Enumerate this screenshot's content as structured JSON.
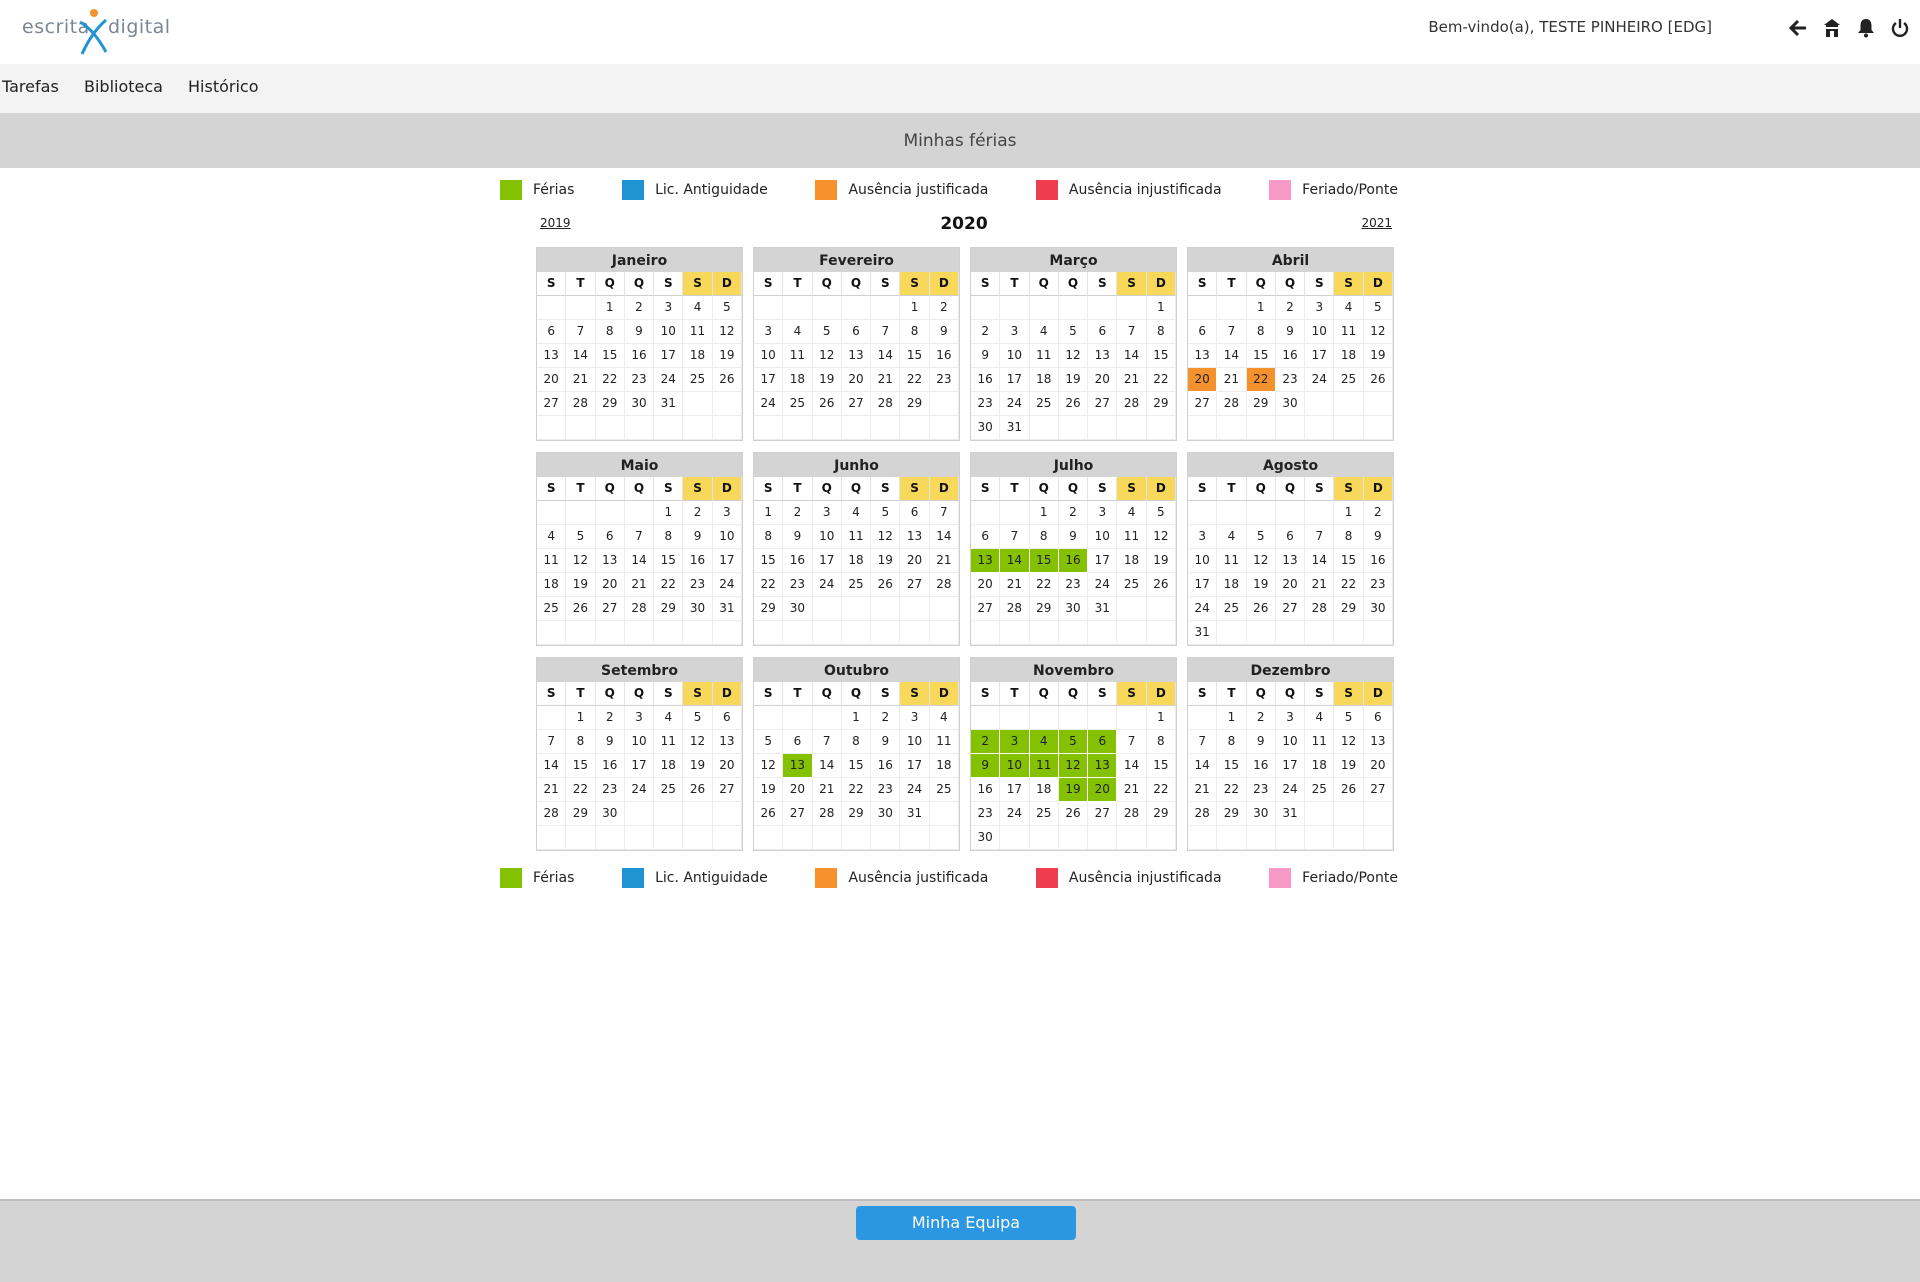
{
  "header": {
    "logo_left": "escrita",
    "logo_right": "digital",
    "welcome": "Bem-vindo(a), TESTE PINHEIRO [EDG]",
    "icons": [
      "back-arrow-icon",
      "home-icon",
      "bell-icon",
      "power-icon"
    ]
  },
  "nav": {
    "items": [
      "Tarefas",
      "Biblioteca",
      "Histórico"
    ]
  },
  "page": {
    "title": "Minhas férias"
  },
  "legend": [
    {
      "label": "Férias",
      "color": "#84c100"
    },
    {
      "label": "Lic. Antiguidade",
      "color": "#1f94d2"
    },
    {
      "label": "Ausência justificada",
      "color": "#f5922d"
    },
    {
      "label": "Ausência injustificada",
      "color": "#ee3e4d"
    },
    {
      "label": "Feriado/Ponte",
      "color": "#f798c6"
    }
  ],
  "year_nav": {
    "prev": "2019",
    "current": "2020",
    "next": "2021"
  },
  "weekday_headers": [
    "S",
    "T",
    "Q",
    "Q",
    "S",
    "S",
    "D"
  ],
  "months": [
    {
      "name": "Janeiro",
      "start": 2,
      "days": 31,
      "marks": {}
    },
    {
      "name": "Fevereiro",
      "start": 5,
      "days": 29,
      "marks": {}
    },
    {
      "name": "Março",
      "start": 6,
      "days": 31,
      "marks": {}
    },
    {
      "name": "Abril",
      "start": 2,
      "days": 30,
      "marks": {
        "20": "ausj",
        "22": "ausj"
      }
    },
    {
      "name": "Maio",
      "start": 4,
      "days": 31,
      "marks": {}
    },
    {
      "name": "Junho",
      "start": 0,
      "days": 30,
      "marks": {}
    },
    {
      "name": "Julho",
      "start": 2,
      "days": 31,
      "marks": {
        "13": "ferias",
        "14": "ferias",
        "15": "ferias",
        "16": "ferias"
      }
    },
    {
      "name": "Agosto",
      "start": 5,
      "days": 31,
      "marks": {}
    },
    {
      "name": "Setembro",
      "start": 1,
      "days": 30,
      "marks": {}
    },
    {
      "name": "Outubro",
      "start": 3,
      "days": 31,
      "marks": {
        "13": "ferias"
      }
    },
    {
      "name": "Novembro",
      "start": 6,
      "days": 30,
      "marks": {
        "2": "ferias",
        "3": "ferias",
        "4": "ferias",
        "5": "ferias",
        "6": "ferias",
        "9": "ferias",
        "10": "ferias",
        "11": "ferias",
        "12": "ferias",
        "13": "ferias",
        "19": "ferias",
        "20": "ferias"
      }
    },
    {
      "name": "Dezembro",
      "start": 1,
      "days": 31,
      "marks": {}
    }
  ],
  "footer": {
    "button": "Minha Equipa"
  }
}
